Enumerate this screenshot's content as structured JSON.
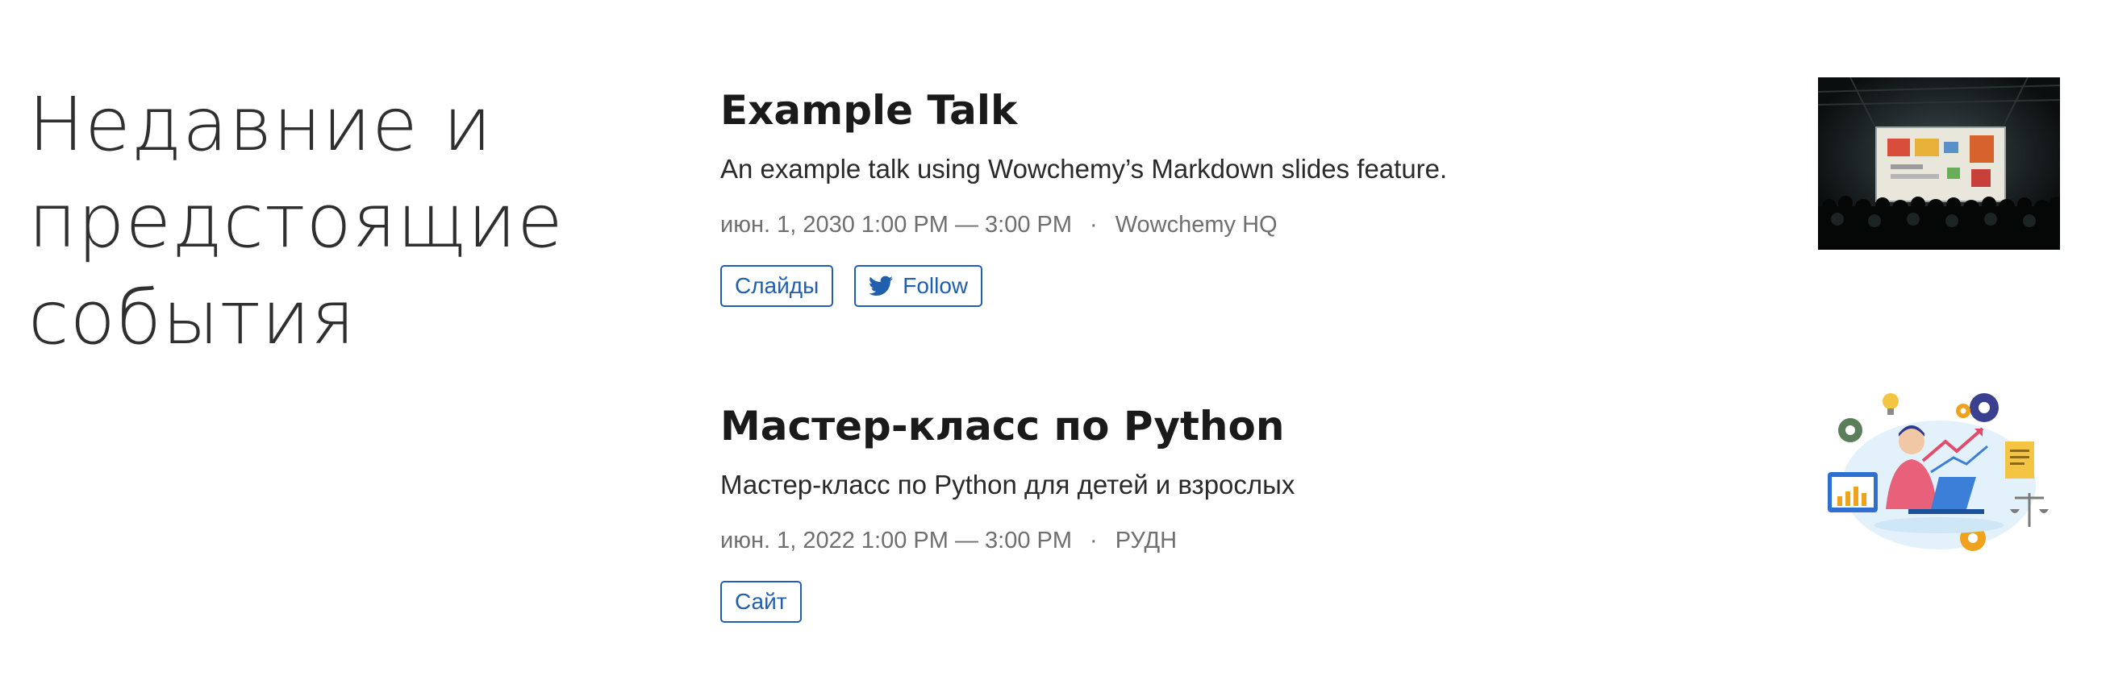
{
  "section": {
    "title": "Недавние и предстоящие события"
  },
  "events": [
    {
      "title": "Example Talk",
      "summary": "An example talk using Wowchemy’s Markdown slides feature.",
      "datetime": "июн. 1, 2030 1:00 PM — 3:00 PM",
      "separator": "·",
      "location": "Wowchemy HQ",
      "buttons": [
        {
          "label": "Слайды",
          "icon": null
        },
        {
          "label": "Follow",
          "icon": "twitter-icon"
        }
      ],
      "image": "conference-talk-photo"
    },
    {
      "title": "Мастер-класс по Python",
      "summary": "Мастер-класс по Python для детей и взрослых",
      "datetime": "июн. 1, 2022 1:00 PM — 3:00 PM",
      "separator": "·",
      "location": "РУДН",
      "buttons": [
        {
          "label": "Сайт",
          "icon": null
        }
      ],
      "image": "python-masterclass-illustration"
    }
  ],
  "colors": {
    "accent": "#1f5fad",
    "heading": "#1a1a1a",
    "meta": "#6f6f6f",
    "twitter": "#1f5fad"
  }
}
